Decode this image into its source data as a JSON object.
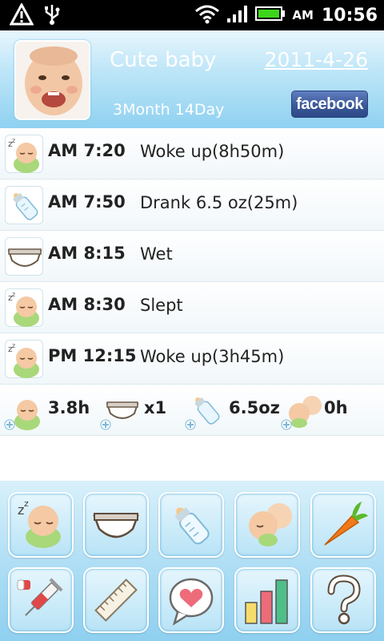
{
  "status_bar": {
    "ampm": "AM",
    "time": "10:56"
  },
  "header": {
    "baby_name": "Cute baby",
    "date": "2011-4-26",
    "age": "3Month 14Day",
    "facebook_label": "facebook"
  },
  "log": [
    {
      "icon": "sleeping-baby-icon",
      "time": "AM 7:20",
      "desc": "Woke up(8h50m)"
    },
    {
      "icon": "bottle-icon",
      "time": "AM 7:50",
      "desc": "Drank 6.5 oz(25m)"
    },
    {
      "icon": "diaper-icon",
      "time": "AM 8:15",
      "desc": "Wet"
    },
    {
      "icon": "sleeping-baby-icon",
      "time": "AM 8:30",
      "desc": "Slept"
    },
    {
      "icon": "sleeping-baby-icon",
      "time": "PM 12:15",
      "desc": "Woke up(3h45m)"
    }
  ],
  "summary": {
    "sleep": "3.8h",
    "diaper": "x1",
    "bottle": "6.5oz",
    "nursing": "0h"
  },
  "toolbar": [
    "sleep-button",
    "diaper-button",
    "bottle-button",
    "nursing-button",
    "food-button",
    "medicine-button",
    "growth-button",
    "notes-button",
    "stats-button",
    "help-button"
  ]
}
